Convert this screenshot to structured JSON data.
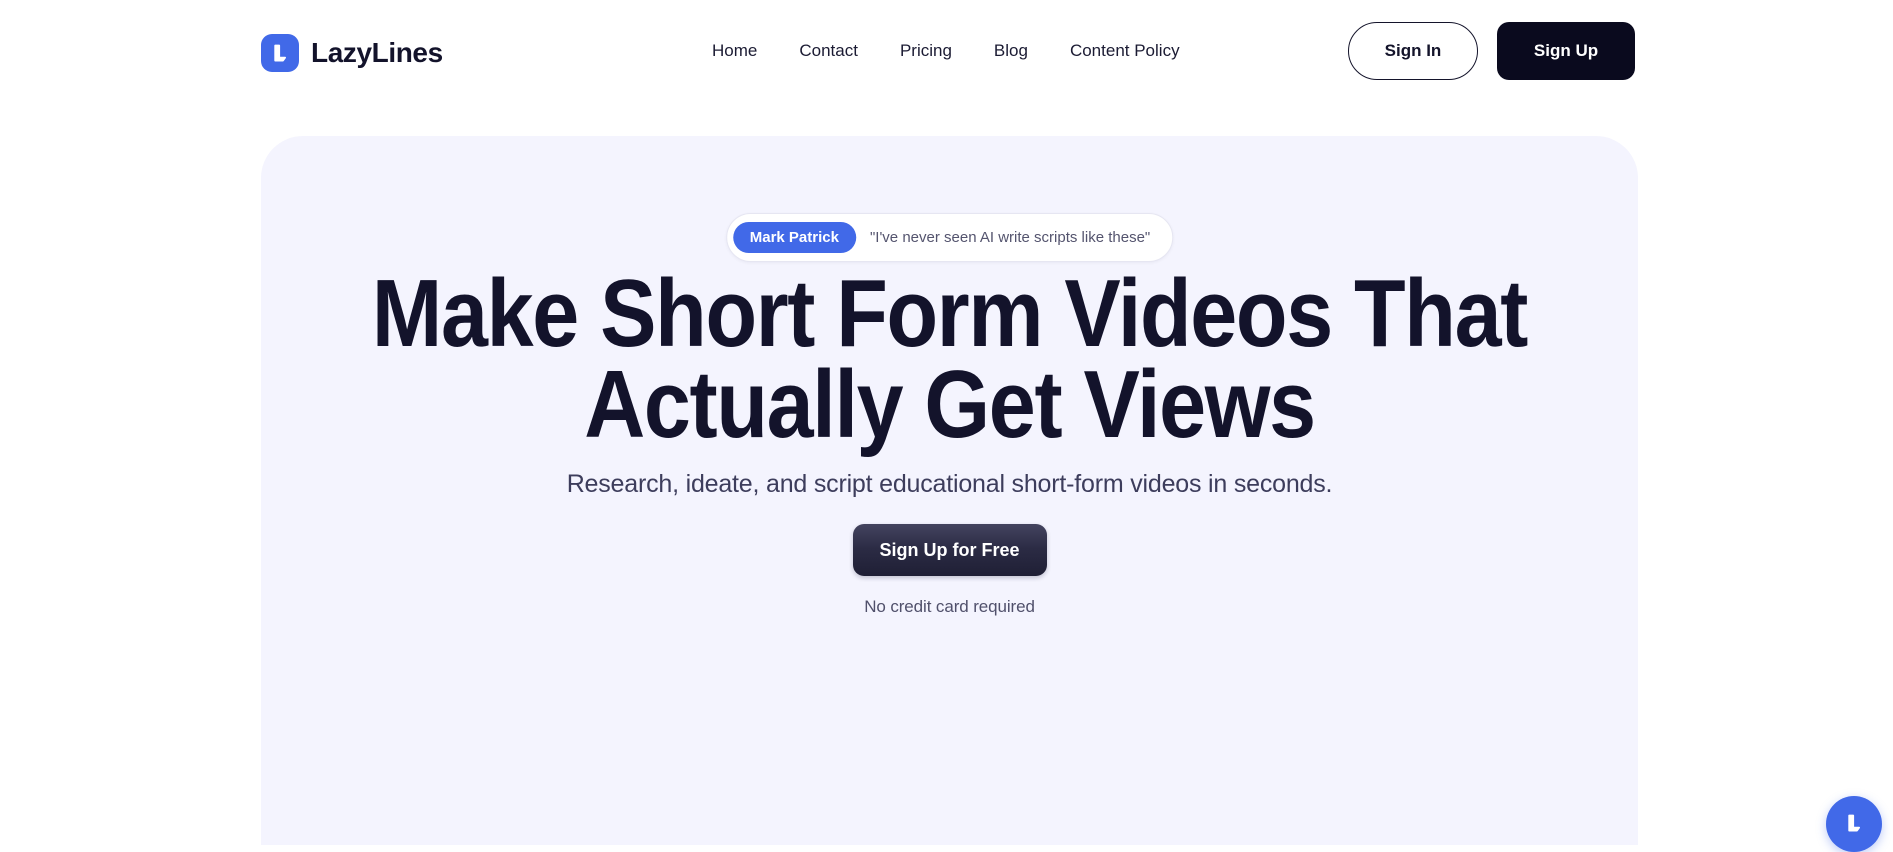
{
  "brand": {
    "name": "LazyLines",
    "logo_icon": "lazylines-l-logo",
    "logo_bg": "#4169E8"
  },
  "nav": {
    "items": [
      {
        "label": "Home"
      },
      {
        "label": "Contact"
      },
      {
        "label": "Pricing"
      },
      {
        "label": "Blog"
      },
      {
        "label": "Content Policy"
      }
    ]
  },
  "auth": {
    "sign_in_label": "Sign In",
    "sign_up_label": "Sign Up",
    "sign_up_bg": "#0A0A1E"
  },
  "hero": {
    "bg": "#F4F4FE",
    "testimonial": {
      "author": "Mark Patrick",
      "quote": "\"I've never seen AI write scripts like these\"",
      "pill_bg": "#4169E8"
    },
    "headline_line1": "Make Short Form Videos That",
    "headline_line2": "Actually Get Views",
    "subheadline": "Research, ideate, and script educational short-form videos in seconds.",
    "cta_label": "Sign Up for Free",
    "cta_note": "No credit card required",
    "headline_color": "#13132B"
  },
  "fab": {
    "icon": "lazylines-l-logo",
    "bg": "#4169E8"
  }
}
